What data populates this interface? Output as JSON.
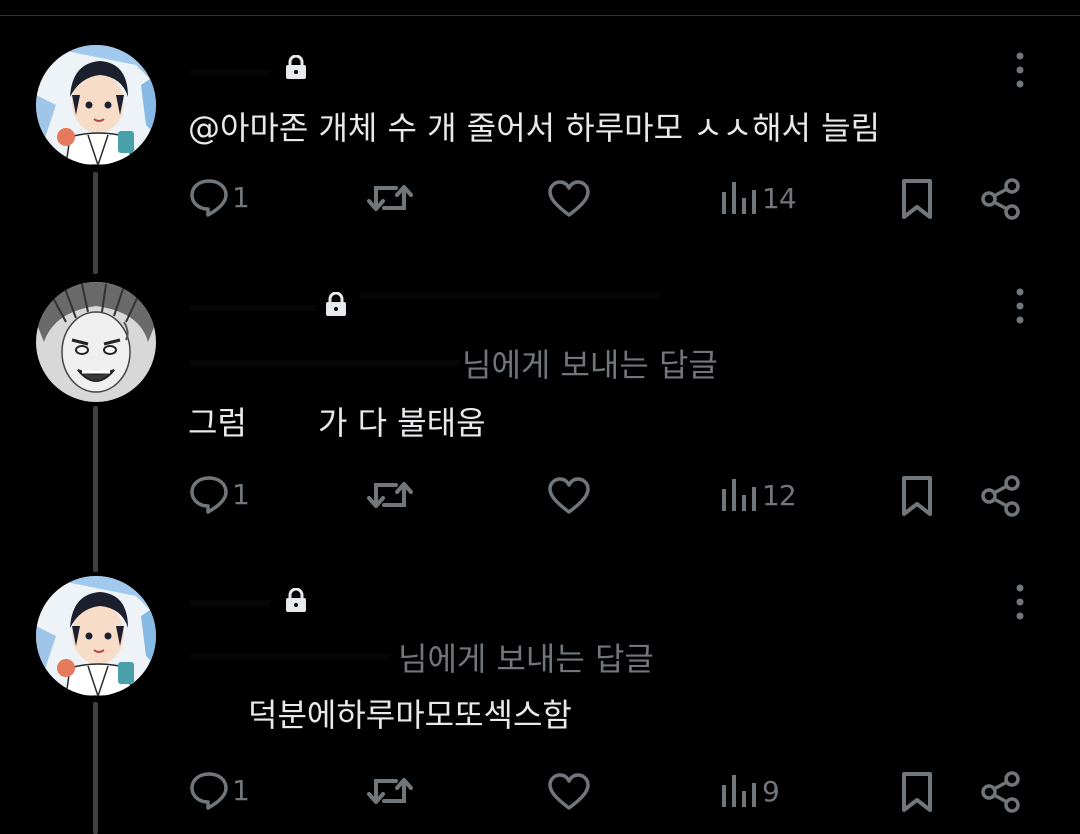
{
  "colors": {
    "background": "#000000",
    "text_primary": "#e7e9ea",
    "text_secondary": "#71767b",
    "thread_line": "#3e4144"
  },
  "posts": [
    {
      "avatar": "avatar-illustrated-boy",
      "text": "@아마존 개체 수 개 줄어서 하루마모 ㅅㅅ해서 늘림",
      "reply_to": "",
      "actions": {
        "replies": "1",
        "reposts": "",
        "likes": "",
        "views": "14"
      }
    },
    {
      "avatar": "avatar-sketch-man",
      "reply_to": "님에게 보내는 답글",
      "text_part1": "그럼",
      "text_part2": "가 다 불태움",
      "actions": {
        "replies": "1",
        "reposts": "",
        "likes": "",
        "views": "12"
      }
    },
    {
      "avatar": "avatar-illustrated-boy",
      "reply_to": "님에게 보내는 답글",
      "text": "덕분에하루마모또섹스함",
      "actions": {
        "replies": "1",
        "reposts": "",
        "likes": "",
        "views": "9"
      }
    }
  ],
  "icons": [
    "lock-icon",
    "more-icon",
    "reply-icon",
    "repost-icon",
    "like-icon",
    "views-icon",
    "bookmark-icon",
    "share-icon"
  ]
}
